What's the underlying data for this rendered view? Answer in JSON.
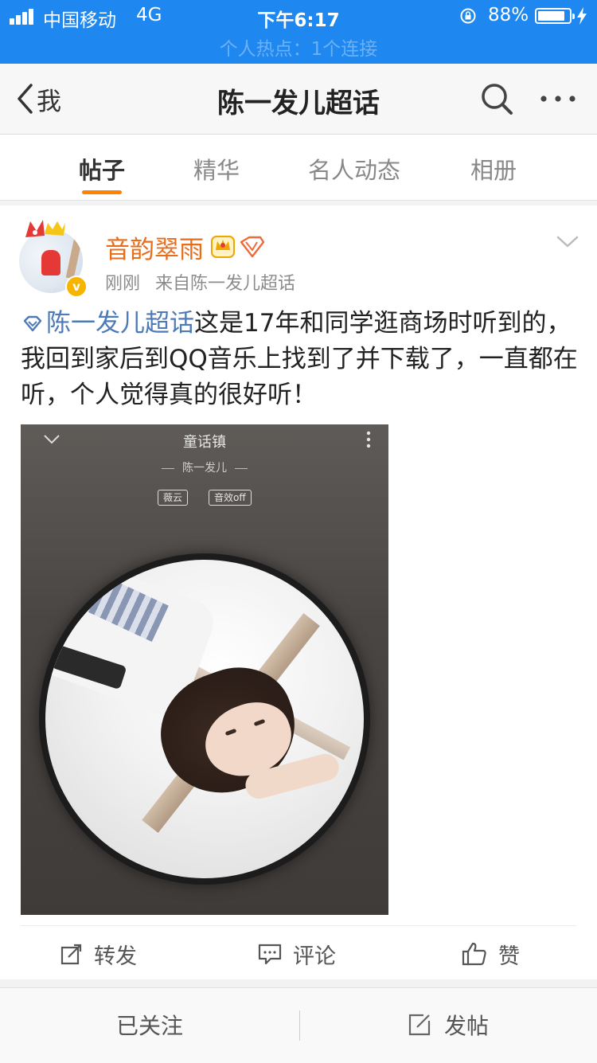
{
  "status_bar": {
    "carrier": "中国移动",
    "network": "4G",
    "time": "下午6:17",
    "battery_percent": "88%",
    "battery_level": 0.88,
    "hotspot_text": "个人热点：1个连接"
  },
  "nav": {
    "back_label": "我",
    "title": "陈一发儿超话"
  },
  "tabs": [
    {
      "label": "帖子",
      "active": true
    },
    {
      "label": "精华",
      "active": false
    },
    {
      "label": "名人动态",
      "active": false
    },
    {
      "label": "相册",
      "active": false
    }
  ],
  "post": {
    "username": "音韵翠雨",
    "time": "刚刚",
    "source": "来自陈一发儿超话",
    "verified_mark": "v",
    "topic": "陈一发儿超话",
    "text": "这是17年和同学逛商场时听到的，我回到家后到QQ音乐上找到了并下载了，一直都在听，个人觉得真的很好听！",
    "image": {
      "song_title": "童话镇",
      "artist": "陈一发儿",
      "chip_1": "薇云",
      "chip_2": "音效off"
    },
    "actions": {
      "repost": "转发",
      "comment": "评论",
      "like": "赞"
    }
  },
  "bottom_bar": {
    "followed": "已关注",
    "compose": "发帖"
  },
  "colors": {
    "status_bar_bg": "#1e87f0",
    "tab_indicator": "#ff8200",
    "username": "#e86c1a",
    "topic_link": "#4d7ab8"
  },
  "icons": [
    "signal-icon",
    "lock-rotation-icon",
    "battery-icon",
    "charging-bolt-icon",
    "back-chevron-icon",
    "search-icon",
    "more-icon",
    "chevron-down-icon",
    "vip-crown-icon",
    "diamond-badge-icon",
    "topic-diamond-icon",
    "repost-icon",
    "comment-icon",
    "like-icon",
    "compose-icon"
  ]
}
